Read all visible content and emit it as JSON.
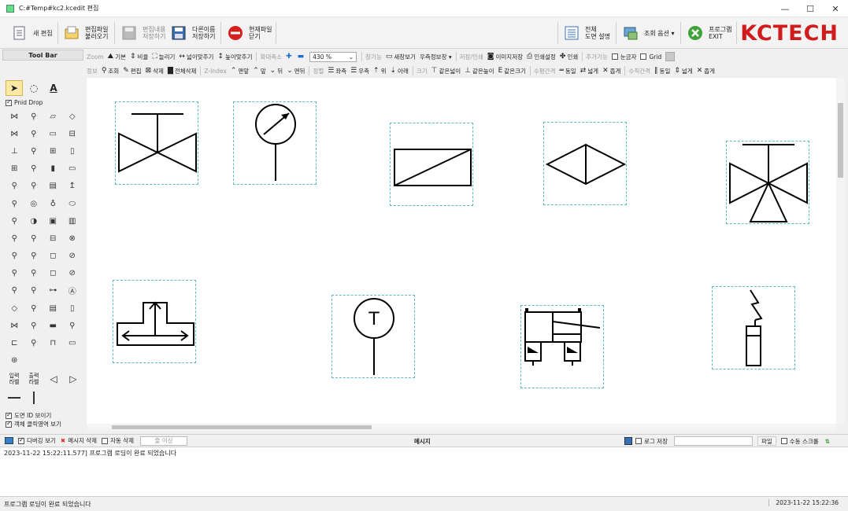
{
  "window": {
    "title": "C:#Temp#kc2.kcedit 편집",
    "min": "—",
    "max": "☐",
    "close": "✕"
  },
  "ribbon": {
    "new_edit": "새 편집",
    "open_file_1": "편집파일",
    "open_file_2": "불러오기",
    "save_1": "편집내용",
    "save_2": "저장하기",
    "save_as_1": "다른이름",
    "save_as_2": "저장하기",
    "close_file_1": "현재파일",
    "close_file_2": "닫기",
    "full_1": "전체",
    "full_2": "도면 설명",
    "view_opt": "조회 옵션 ▾",
    "exit_1": "프로그램",
    "exit_2": "EXIT",
    "brand": "KCTECH"
  },
  "toolbar1": {
    "zoom": "Zoom",
    "basic": "기본",
    "ratio": "비율",
    "stretch": "늘리기",
    "fit_w": "넓이맞추기",
    "fit_h": "높이맞추기",
    "zoom_in_out": "확대축소",
    "zoom_value": "430 %",
    "window_fn": "창기능",
    "new_window": "새창보기",
    "right_info": "우측정보창 ▾",
    "save_print": "저장/인쇄",
    "img_save": "이미지저장",
    "print_setup": "인쇄설정",
    "print": "인쇄",
    "extra": "추가기능",
    "ruler": "눈금자",
    "grid": "Grid"
  },
  "toolbar2": {
    "info": "정보",
    "view": "조회",
    "edit": "편집",
    "delete": "삭제",
    "delete_all": "전체삭제",
    "zindex": "Z-Index",
    "front": "맨앞",
    "forward": "앞",
    "backward": "뒤",
    "back": "맨뒤",
    "align": "정렬",
    "left": "좌측",
    "right": "우측",
    "top": "위",
    "bottom": "아래",
    "size": "크기",
    "same_w": "같은넓이",
    "same_h": "같은높이",
    "same_size": "같은크기",
    "h_spacing": "수평간격",
    "equal": "동일",
    "wider": "넓게",
    "narrower": "좁게",
    "v_spacing": "수직간격",
    "equal2": "동일",
    "wider2": "넓게",
    "narrower2": "좁게"
  },
  "left": {
    "toolbar_label": "Tool Bar",
    "pnid_drop": "Pnid Drop",
    "show_id": "도면 ID 보이기",
    "show_click": "객체 클릭영역 보기",
    "in_label_1": "입력",
    "in_label_2": "라벨",
    "out_label_1": "출력",
    "out_label_2": "라벨",
    "icons": [
      "⋈",
      "⚲",
      "▱",
      "◇",
      "⋈",
      "⚲",
      "▭",
      "⊟",
      "⊥",
      "⚲",
      "⊞",
      "▯",
      "⊞",
      "⚲",
      "▮",
      "▭",
      "⚲",
      "⚲",
      "▤",
      "↥",
      "⚲",
      "◎",
      "♁",
      "⬭",
      "⚲",
      "◑",
      "▣",
      "▥",
      "⚲",
      "⚲",
      "⊟",
      "⊗",
      "⚲",
      "⚲",
      "◻",
      "⊘",
      "⚲",
      "⚲",
      "◻",
      "⊘",
      "⚲",
      "⚲",
      "⊶",
      "Ⓐ",
      "◇",
      "⚲",
      "▤",
      "▯",
      "⋈",
      "⚲",
      "▬",
      "⚲",
      "⊏",
      "⚲",
      "⊓",
      "▭",
      "⊛",
      "",
      "",
      ""
    ]
  },
  "messages": {
    "debug_view": "디버깅 보기",
    "delete_msg": "메시지 삭제",
    "auto_delete": "자동 삭제",
    "count_placeholder": "줄 이상",
    "title": "메시지",
    "log_save": "로그 저장",
    "file": "파일",
    "manual_scroll": "수동 스크롤",
    "log_line": "2023-11-22 15:22:11.577] 프로그램 로딩이 완료 되었습니다"
  },
  "status": {
    "text": "프로그램 로딩이 완료 되었습니다",
    "clock": "2023-11-22 15:22:36"
  }
}
